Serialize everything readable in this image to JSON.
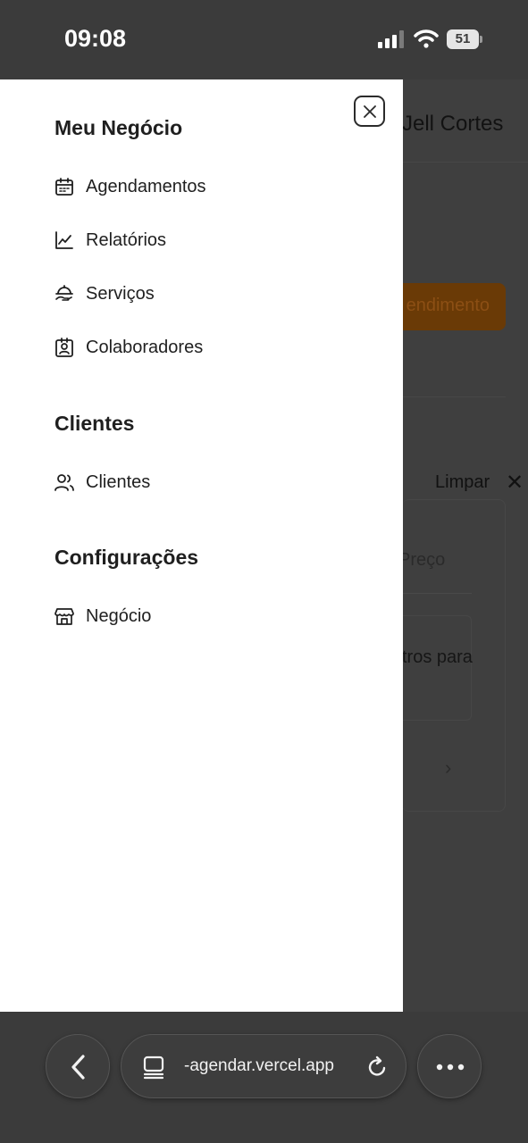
{
  "status_bar": {
    "time": "09:08",
    "battery": "51",
    "icons": [
      "cellular-signal-icon",
      "wifi-icon",
      "battery-icon"
    ]
  },
  "background_page": {
    "user_name": "Jell Cortes",
    "cta_label": "endimento",
    "clear_label": "Limpar",
    "price_placeholder": "Preço",
    "filter_text": "tros para",
    "chevron": "›"
  },
  "drawer": {
    "close_icon": "close-icon",
    "sections": [
      {
        "title": "Meu Negócio",
        "items": [
          {
            "label": "Agendamentos",
            "icon": "calendar-icon"
          },
          {
            "label": "Relatórios",
            "icon": "chart-line-icon"
          },
          {
            "label": "Serviços",
            "icon": "service-hand-icon"
          },
          {
            "label": "Colaboradores",
            "icon": "badge-user-icon"
          }
        ]
      },
      {
        "title": "Clientes",
        "items": [
          {
            "label": "Clientes",
            "icon": "users-icon"
          }
        ]
      },
      {
        "title": "Configurações",
        "items": [
          {
            "label": "Negócio",
            "icon": "store-icon"
          }
        ]
      }
    ]
  },
  "browser": {
    "url": "-agendar.vercel.app",
    "back_icon": "chevron-left-icon",
    "tabs_icon": "tabs-icon",
    "reload_icon": "reload-icon",
    "more_icon": "more-icon"
  }
}
